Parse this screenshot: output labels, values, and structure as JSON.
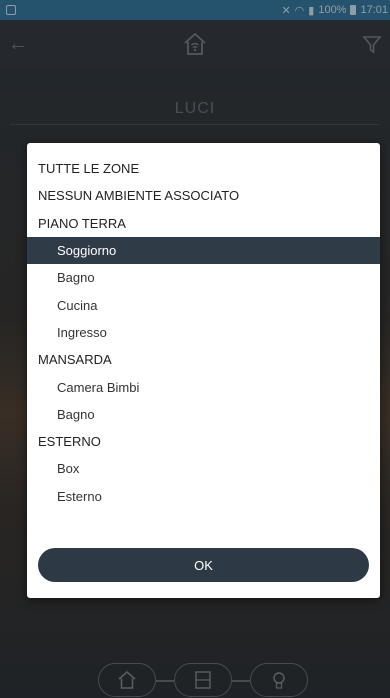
{
  "status_bar": {
    "battery": "100%",
    "time": "17:01"
  },
  "app_bar": {
    "back_icon": "arrow-left-icon",
    "home_icon": "home-wifi-icon",
    "filter_icon": "filter-icon"
  },
  "page": {
    "title": "LUCI"
  },
  "dialog": {
    "items": [
      {
        "label": "TUTTE LE ZONE",
        "type": "header"
      },
      {
        "label": "NESSUN AMBIENTE ASSOCIATO",
        "type": "header"
      },
      {
        "label": "PIANO TERRA",
        "type": "header"
      },
      {
        "label": "Soggiorno",
        "type": "sub",
        "selected": true
      },
      {
        "label": "Bagno",
        "type": "sub"
      },
      {
        "label": "Cucina",
        "type": "sub"
      },
      {
        "label": "Ingresso",
        "type": "sub"
      },
      {
        "label": "MANSARDA",
        "type": "header"
      },
      {
        "label": "Camera Bimbi",
        "type": "sub"
      },
      {
        "label": "Bagno",
        "type": "sub"
      },
      {
        "label": "ESTERNO",
        "type": "header"
      },
      {
        "label": "Box",
        "type": "sub"
      },
      {
        "label": "Esterno",
        "type": "sub"
      }
    ],
    "ok_label": "OK"
  },
  "bottom_nav": {
    "items": [
      "home-wifi-icon",
      "control-panel-icon",
      "light-bulb-icon"
    ]
  },
  "colors": {
    "status_bar": "#3a7fa6",
    "selected_row": "#2f3c47",
    "ok_button": "#2d3a45"
  }
}
